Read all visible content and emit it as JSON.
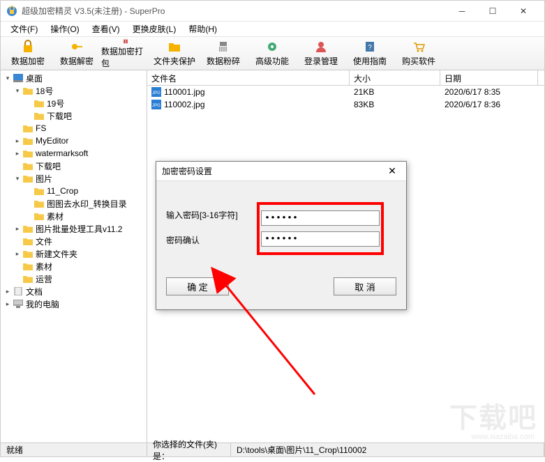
{
  "window": {
    "title": "超级加密精灵 V3.5(未注册) - SuperPro"
  },
  "menu": {
    "file": "文件(F)",
    "operate": "操作(O)",
    "view": "查看(V)",
    "skin": "更换皮肤(L)",
    "help": "帮助(H)"
  },
  "toolbar": {
    "encrypt": "数据加密",
    "decrypt": "数据解密",
    "pack": "数据加密打包",
    "folder_protect": "文件夹保护",
    "shred": "数据粉碎",
    "advanced": "高级功能",
    "login": "登录管理",
    "guide": "使用指南",
    "buy": "购买软件"
  },
  "tree": {
    "desktop": "桌面",
    "n18": "18号",
    "n19": "19号",
    "xiazaiba1": "下载吧",
    "fs": "FS",
    "myeditor": "MyEditor",
    "watermarksoft": "watermarksoft",
    "xiazaiba2": "下载吧",
    "pictures": "图片",
    "crop": "11_Crop",
    "dewatermark": "图图去水印_转换目录",
    "material1": "素材",
    "batch": "图片批量处理工具v11.2",
    "files": "文件",
    "newfolder": "新建文件夹",
    "material2": "素材",
    "operate": "运营",
    "documents": "文档",
    "computer": "我的电脑"
  },
  "cols": {
    "name": "文件名",
    "size": "大小",
    "date": "日期"
  },
  "files": {
    "f1": {
      "name": "110001.jpg",
      "size": "21KB",
      "date": "2020/6/17 8:35"
    },
    "f2": {
      "name": "110002.jpg",
      "size": "83KB",
      "date": "2020/6/17 8:36"
    }
  },
  "dialog": {
    "title": "加密密码设置",
    "label_pwd": "输入密码[3-16字符]",
    "label_confirm": "密码确认",
    "val_pwd": "******",
    "val_confirm": "******",
    "ok": "确 定",
    "cancel": "取 消"
  },
  "status": {
    "ready": "就绪",
    "selected_label": "你选择的文件(夹)是：",
    "path": "D:\\tools\\桌面\\图片\\11_Crop\\110002"
  },
  "watermark": {
    "main": "下载吧",
    "sub": "www.xiazaiba.com"
  }
}
